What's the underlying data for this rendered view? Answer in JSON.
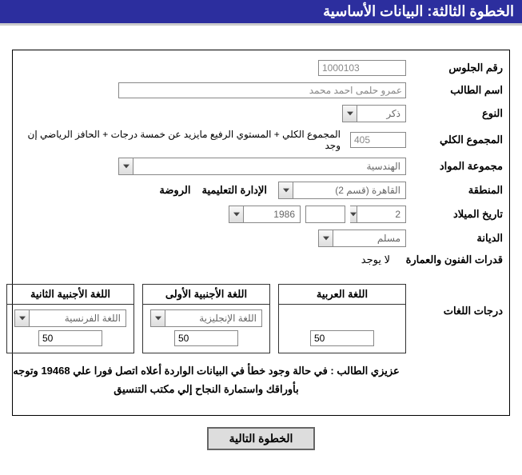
{
  "header": {
    "title": "الخطوة الثالثة: البيانات الأساسية"
  },
  "labels": {
    "seat_no": "رقم الجلوس",
    "student_name": "اسم الطالب",
    "gender": "النوع",
    "total": "المجموع الكلي",
    "subject_group": "مجموعة المواد",
    "region": "المنطقة",
    "edu_admin": "الإدارة التعليمية",
    "birth_date": "تاريخ الميلاد",
    "religion": "الديانة",
    "arts_arch": "قدرات الفنون والعمارة",
    "lang_scores": "درجات اللغات"
  },
  "values": {
    "seat_no": "1000103",
    "student_name": "عمرو حلمى احمد محمد",
    "gender": "ذكر",
    "total": "405",
    "total_hint": "المجموع الكلي + المستوي الرفيع مايزيد عن خمسة درجات + الحافز الرياضي إن وجد",
    "subject_group": "الهندسية",
    "region": "القاهرة (قسم 2)",
    "edu_admin_value": "الروضة",
    "birth_day": "2",
    "birth_month": "",
    "birth_year": "1986",
    "religion": "مسلم",
    "arts_arch": "لا يوجد"
  },
  "languages": {
    "arabic": {
      "header": "اللغة العربية",
      "score": "50"
    },
    "first_foreign": {
      "header": "اللغة الأجنبية الأولى",
      "name": "اللغة الإنجليزية",
      "score": "50"
    },
    "second_foreign": {
      "header": "اللغة الأجنبية الثانية",
      "name": "اللغة الفرنسية",
      "score": "50"
    }
  },
  "note": "عزيزي الطالب : في حالة وجود خطأ في البيانات الواردة أعلاه اتصل فورا علي 19468 وتوجه بأوراقك واستمارة النجاح إلي مكتب التنسيق",
  "buttons": {
    "next": "الخطوة التالية"
  }
}
